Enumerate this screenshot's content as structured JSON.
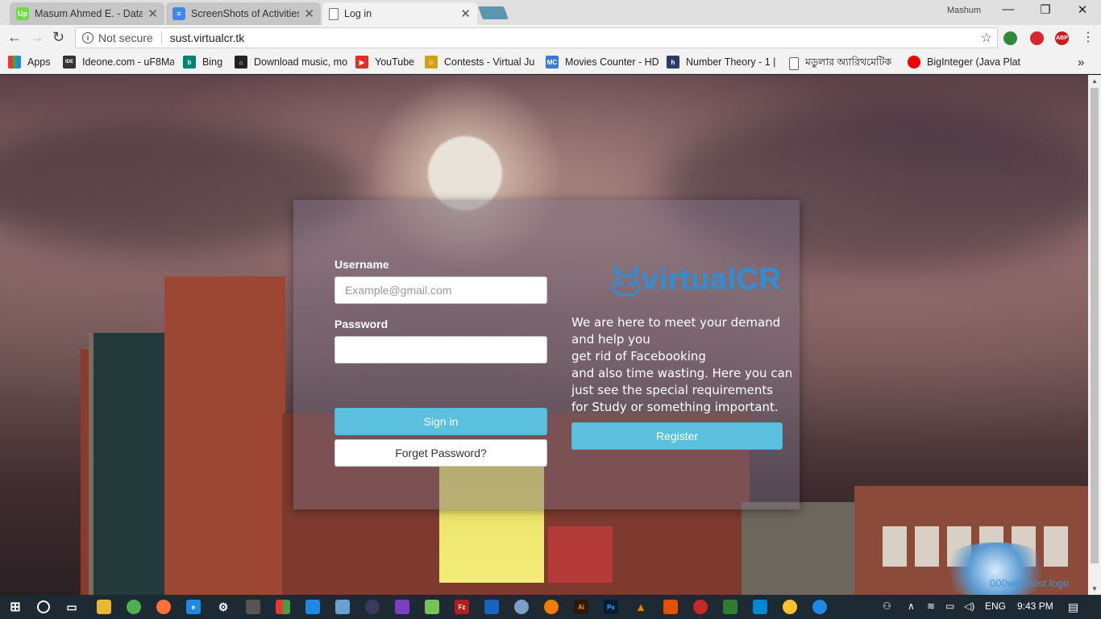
{
  "browser": {
    "tabs": [
      {
        "title": "Masum Ahmed E. - Data",
        "favicon": "upwork-icon",
        "color": "#6fda44"
      },
      {
        "title": "ScreenShots of Activities",
        "favicon": "google-docs-icon",
        "color": "#4285f4"
      },
      {
        "title": "Log in",
        "favicon": "page-icon",
        "color": "#ffffff"
      }
    ],
    "profile_name": "Mashum",
    "address": {
      "security_label": "Not secure",
      "url": "sust.virtualcr.tk"
    },
    "bookmarks": [
      {
        "label": "Apps",
        "icon": "apps-grid-icon"
      },
      {
        "label": "Ideone.com - uF8Ma",
        "icon": "ideone-icon"
      },
      {
        "label": "Bing",
        "icon": "bing-icon"
      },
      {
        "label": "Download music, mo",
        "icon": "download-icon"
      },
      {
        "label": "YouTube",
        "icon": "youtube-icon"
      },
      {
        "label": "Contests - Virtual Ju",
        "icon": "vjudge-icon"
      },
      {
        "label": "Movies Counter - HD",
        "icon": "mc-icon"
      },
      {
        "label": "Number Theory - 1 |",
        "icon": "h-icon"
      },
      {
        "label": "মডুলার অ্যারিথমেটিক",
        "icon": "page-icon"
      },
      {
        "label": "BigInteger (Java Platf",
        "icon": "oracle-icon"
      }
    ],
    "extensions": [
      "extension-green-icon",
      "extension-red-icon",
      "adblock-plus-icon"
    ],
    "adblock_label": "ABP"
  },
  "login": {
    "username_label": "Username",
    "username_placeholder": "Example@gmail.com",
    "password_label": "Password",
    "signin_label": "Sign in",
    "forget_label": "Forget Password?",
    "register_label": "Register"
  },
  "brand": {
    "logo_text": "virtualCR",
    "tagline_lines": [
      "We are here to meet your demand",
      "and help you",
      "get rid of Facebooking",
      "and also time wasting. Here you can",
      "just see the special requirements",
      "for Study or something important."
    ]
  },
  "host_logo_alt": "000webhost logo",
  "taskbar": {
    "language": "ENG",
    "time": "9:43 PM"
  },
  "colors": {
    "accent": "#5bc0de",
    "logo": "#2e8fd6"
  }
}
